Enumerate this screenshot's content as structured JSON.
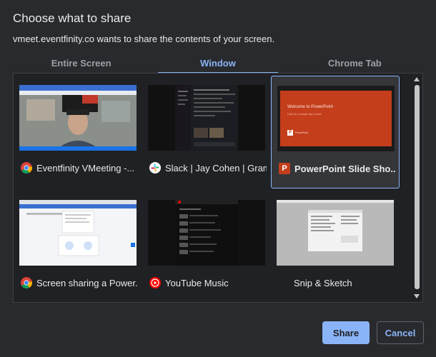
{
  "dialog": {
    "title": "Choose what to share",
    "subtitle": "vmeet.eventfinity.co wants to share the contents of your screen."
  },
  "tabs": [
    {
      "label": "Entire Screen",
      "active": false
    },
    {
      "label": "Window",
      "active": true
    },
    {
      "label": "Chrome Tab",
      "active": false
    }
  ],
  "windows": [
    {
      "label": "Eventfinity VMeeting -...",
      "icon": "chrome-icon",
      "selected": false
    },
    {
      "label": "Slack | Jay Cohen | Gram...",
      "icon": "slack-icon",
      "selected": false
    },
    {
      "label": "PowerPoint Slide Sho...",
      "icon": "powerpoint-icon",
      "selected": true
    },
    {
      "label": "Screen sharing a Power...",
      "icon": "chrome-icon",
      "selected": false
    },
    {
      "label": "YouTube Music",
      "icon": "youtube-music-icon",
      "selected": false
    },
    {
      "label": "Snip & Sketch",
      "icon": "",
      "selected": false
    }
  ],
  "slide": {
    "title": "Welcome to PowerPoint",
    "subtitle": "5 tips for a simpler way to work",
    "app": "PowerPoint"
  },
  "buttons": {
    "share": "Share",
    "cancel": "Cancel"
  },
  "colors": {
    "accent": "#8ab4f8",
    "background": "#292a2d",
    "slide_red": "#c43e1c"
  }
}
